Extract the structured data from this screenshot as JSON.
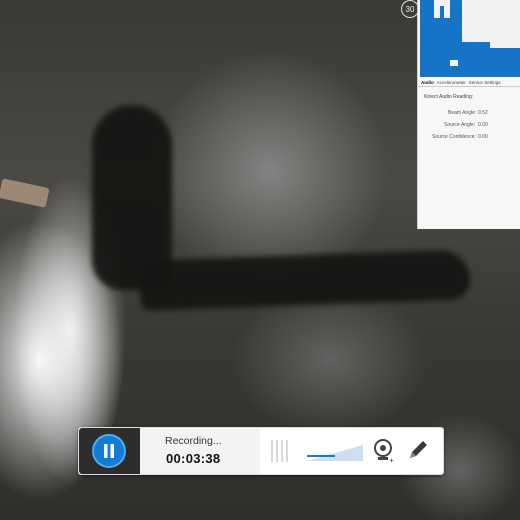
{
  "overlay_badges": {
    "left": "30",
    "right": ""
  },
  "panel": {
    "tabs": [
      "Audio",
      "Accelerometer",
      "Sensor Settings"
    ],
    "heading": "Kinect Audio Reading:",
    "readings": [
      {
        "label": "Beam Angle:",
        "value": "0.52"
      },
      {
        "label": "Source Angle:",
        "value": "0.00"
      },
      {
        "label": "Source Confidence:",
        "value": "0.00"
      }
    ]
  },
  "recorder": {
    "status": "Recording...",
    "elapsed": "00:03:38",
    "volume_level": 0.5,
    "accent_color": "#0f7dd6"
  },
  "icons": [
    "pause-icon",
    "audio-meter-icon",
    "volume-slider-icon",
    "webcam-add-icon",
    "pen-icon"
  ]
}
